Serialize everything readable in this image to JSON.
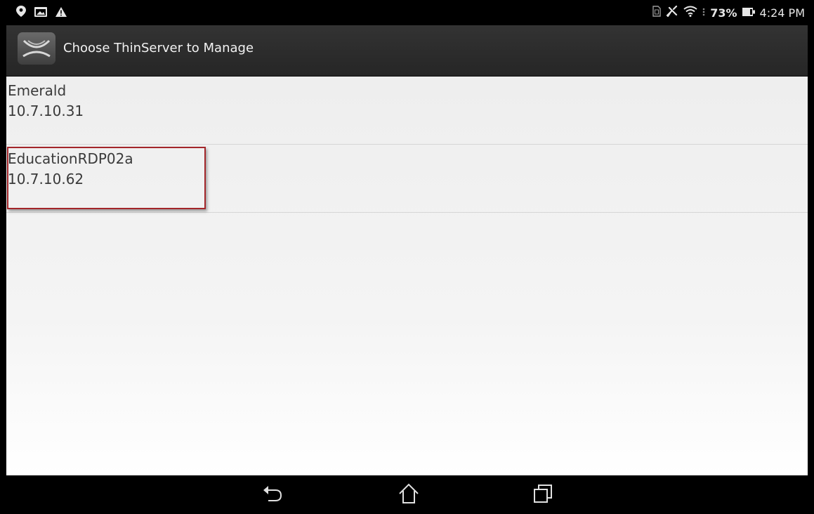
{
  "status_bar": {
    "left_icons": [
      "location-pin-icon",
      "image-icon",
      "warning-icon"
    ],
    "right_icons": [
      "sim-icon",
      "airplane-mute-icon",
      "wifi-icon"
    ],
    "battery_percent": "73%",
    "time": "4:24 PM"
  },
  "action_bar": {
    "app_icon": "thinmanager-logo-icon",
    "title": "Choose ThinServer to Manage"
  },
  "servers": [
    {
      "name": "Emerald",
      "ip": "10.7.10.31"
    },
    {
      "name": "EducationRDP02a",
      "ip": "10.7.10.62"
    }
  ],
  "annotation": {
    "highlight_color": "#a3262a",
    "highlighted_item_index": 1
  },
  "nav_bar": {
    "buttons": [
      "back-icon",
      "home-icon",
      "recent-apps-icon"
    ]
  }
}
